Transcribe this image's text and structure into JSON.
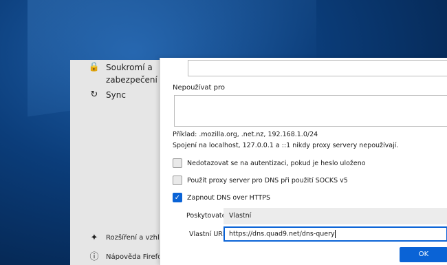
{
  "sidebar": {
    "privacy_label": "Soukromí a zabezpečení",
    "sync_label": "Sync",
    "extensions_label": "Rozšíření a vzhled",
    "help_label": "Nápověda Firefox"
  },
  "dialog": {
    "no_proxy_label": "Nepoužívat pro",
    "no_proxy_value": "",
    "example_text": "Příklad: .mozilla.org, .net.nz, 192.168.1.0/24",
    "localhost_note": "Spojení na localhost, 127.0.0.1 a ::1 nikdy proxy servery nepoužívají.",
    "checkbox_auth_label": "Nedotazovat se na autentizaci, pokud je heslo uloženo",
    "checkbox_auth_checked": false,
    "checkbox_socks_dns_label": "Použít proxy server pro DNS při použití SOCKS v5",
    "checkbox_socks_dns_checked": false,
    "checkbox_doh_label": "Zapnout DNS over HTTPS",
    "checkbox_doh_checked": true,
    "provider_label": "Poskytovatel",
    "provider_value": "Vlastní",
    "custom_url_label": "Vlastní URL",
    "custom_url_value": "https://dns.quad9.net/dns-query",
    "ok_label": "OK"
  },
  "colors": {
    "accent": "#0a63d6",
    "desktop": "#0b3d7a"
  }
}
